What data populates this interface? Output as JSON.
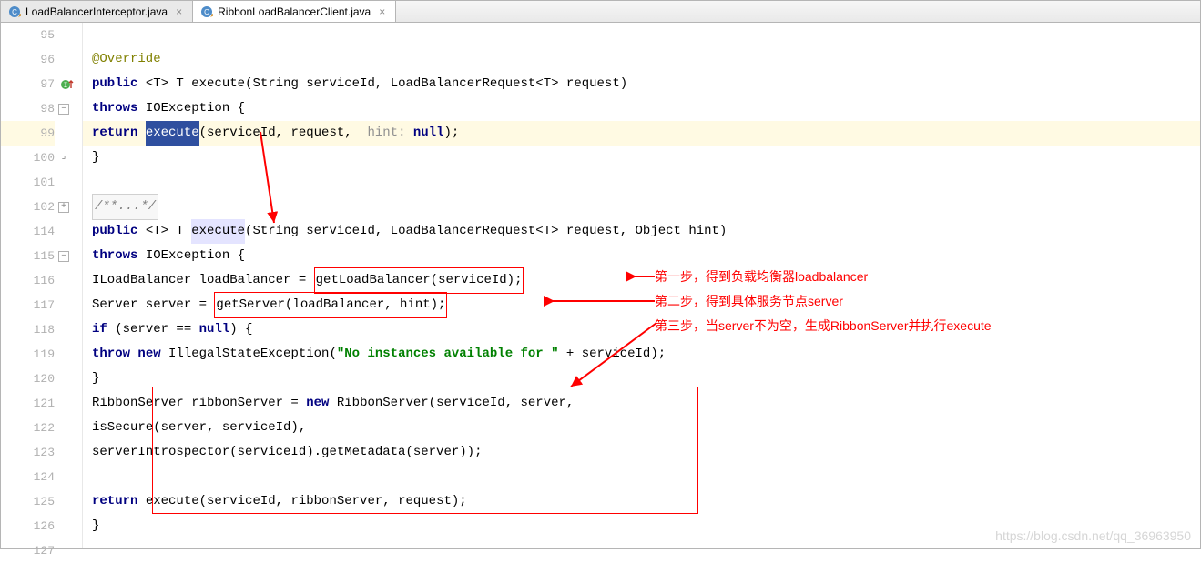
{
  "tabs": [
    {
      "name": "LoadBalancerInterceptor.java",
      "active": false
    },
    {
      "name": "RibbonLoadBalancerClient.java",
      "active": true
    }
  ],
  "lines": {
    "l95": {
      "num": "95"
    },
    "l96": {
      "num": "96",
      "ann": "@Override"
    },
    "l97": {
      "num": "97",
      "kw_public": "public",
      "gen": "<T> T ",
      "method": "execute",
      "sig_rest": "(String serviceId, LoadBalancerRequest<T> request)"
    },
    "l98": {
      "num": "98",
      "kw_throws": "throws",
      "exc": " IOException {"
    },
    "l99": {
      "num": "99",
      "kw_return": "return ",
      "call": "execute",
      "after": "(serviceId, request,  ",
      "hint": "hint:",
      "null": " null",
      "tail": ");"
    },
    "l100": {
      "num": "100",
      "txt": "}"
    },
    "l101": {
      "num": "101"
    },
    "l102": {
      "num": "102",
      "cmt": "/**...*/"
    },
    "l114": {
      "num": "114",
      "kw_public": "public",
      "gen": " <T> T ",
      "method": "execute",
      "sig_rest": "(String serviceId, LoadBalancerRequest<T> request, Object hint)"
    },
    "l115": {
      "num": "115",
      "kw_throws": "throws",
      "exc": " IOException {"
    },
    "l116": {
      "num": "116",
      "pre": "ILoadBalancer loadBalancer = ",
      "boxed": "getLoadBalancer(serviceId);"
    },
    "l117": {
      "num": "117",
      "pre": "Server server = ",
      "boxed": "getServer(loadBalancer, hint);"
    },
    "l118": {
      "num": "118",
      "kw_if": "if",
      "cond": " (server == ",
      "null": "null",
      "tail": ") {"
    },
    "l119": {
      "num": "119",
      "kw_throw": "throw",
      "kw_new": " new",
      "cls": " IllegalStateException(",
      "str": "\"No instances available for \"",
      "tail": " + serviceId);"
    },
    "l120": {
      "num": "120",
      "txt": "}"
    },
    "l121": {
      "num": "121",
      "pre": "RibbonServer ribbonServer = ",
      "kw_new": "new",
      "rest": " RibbonServer(serviceId, server,"
    },
    "l122": {
      "num": "122",
      "txt": "isSecure(server, serviceId),"
    },
    "l123": {
      "num": "123",
      "txt": "serverIntrospector(serviceId).getMetadata(server));"
    },
    "l124": {
      "num": "124"
    },
    "l125": {
      "num": "125",
      "kw_return": "return",
      "rest": " execute(serviceId, ribbonServer, request);"
    },
    "l126": {
      "num": "126",
      "txt": "}"
    },
    "l127": {
      "num": "127"
    }
  },
  "annotations": {
    "step1": "第一步，得到负载均衡器loadbalancer",
    "step2": "第二步，得到具体服务节点server",
    "step3": "第三步，当server不为空，生成RibbonServer并执行execute"
  },
  "watermark": "https://blog.csdn.net/qq_36963950"
}
